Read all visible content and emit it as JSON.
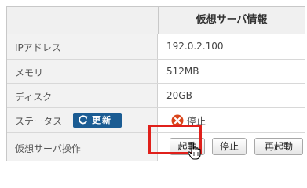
{
  "table": {
    "header_title": "仮想サーバ情報",
    "rows": [
      {
        "label": "IPアドレス",
        "value": "192.0.2.100"
      },
      {
        "label": "メモリ",
        "value": "512MB"
      },
      {
        "label": "ディスク",
        "value": "20GB"
      },
      {
        "label": "ステータス",
        "value": "停止",
        "status_icon": "stop-icon",
        "status_color": "#d9441a"
      },
      {
        "label": "仮想サーバ操作"
      }
    ]
  },
  "update_button": {
    "label": "更新",
    "icon": "refresh-icon",
    "color": "#1b5c93"
  },
  "operations": {
    "start_label": "起動",
    "stop_label": "停止",
    "restart_label": "再起動"
  },
  "highlight_color": "#e0201b"
}
